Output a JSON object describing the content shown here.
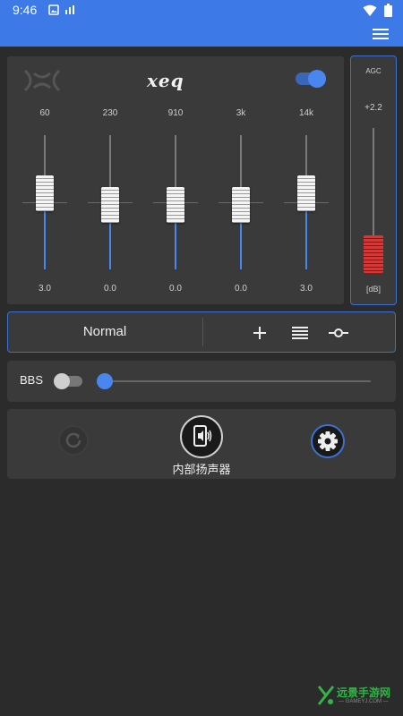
{
  "status_bar": {
    "time": "9:46",
    "icons_left": [
      "gallery-icon",
      "signal-bars-icon"
    ],
    "icons_right": [
      "wifi-icon",
      "battery-icon"
    ]
  },
  "app_bar": {
    "menu_icon": "menu-icon",
    "color": "#3d7ae8"
  },
  "eq": {
    "logo": "xeq",
    "power_on": true,
    "bands": [
      {
        "freq": "60",
        "gain": "3.0"
      },
      {
        "freq": "230",
        "gain": "0.0"
      },
      {
        "freq": "910",
        "gain": "0.0"
      },
      {
        "freq": "3k",
        "gain": "0.0"
      },
      {
        "freq": "14k",
        "gain": "3.0"
      }
    ]
  },
  "agc": {
    "label": "AGC",
    "value": "+2.2",
    "unit": "[dB]"
  },
  "preset": {
    "name": "Normal",
    "actions": [
      "plus-icon",
      "list-icon",
      "node-icon"
    ]
  },
  "bbs": {
    "label": "BBS",
    "enabled": false,
    "level": 0
  },
  "output": {
    "device_label": "内部扬声器",
    "reset_icon": "refresh-icon",
    "device_icon": "phone-speaker-icon",
    "settings_icon": "gear-icon"
  },
  "watermark": {
    "title": "远景手游网",
    "subtitle": "— GAMEYJ.COM —"
  },
  "colors": {
    "accent": "#4a86f0",
    "panel": "#3a3a3a",
    "background": "#2b2b2b",
    "agc_fader": "#e53030"
  }
}
